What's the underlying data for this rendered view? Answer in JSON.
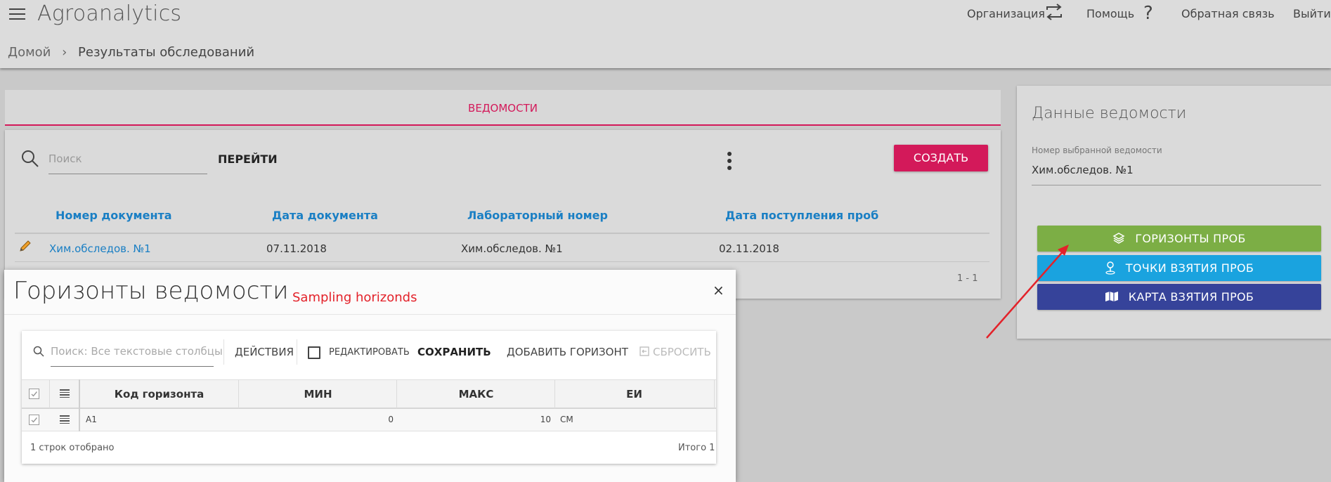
{
  "app": {
    "title": "Agroanalytics"
  },
  "header": {
    "org_label": "Организация",
    "help_label": "Помощь",
    "feedback_label": "Обратная связь",
    "logout_label": "Выйти"
  },
  "breadcrumb": {
    "home": "Домой",
    "current": "Результаты обследований"
  },
  "tab": {
    "label": "ВЕДОМОСТИ"
  },
  "list": {
    "search_placeholder": "Поиск",
    "goto_label": "ПЕРЕЙТИ",
    "create_label": "СОЗДАТЬ",
    "columns": [
      "Номер документа",
      "Дата документа",
      "Лабораторный номер",
      "Дата поступления проб"
    ],
    "rows": [
      {
        "doc_number": "Хим.обследов. №1",
        "doc_date": "07.11.2018",
        "lab_number": "Хим.обследов. №1",
        "receipt_date": "02.11.2018"
      }
    ],
    "pager": "1 - 1"
  },
  "details": {
    "title": "Данные ведомости",
    "number_label": "Номер выбранной ведомости",
    "number_value": "Хим.обследов. №1",
    "btn_horizons": "ГОРИЗОНТЫ ПРОБ",
    "btn_points": "ТОЧКИ ВЗЯТИЯ ПРОБ",
    "btn_map": "КАРТА ВЗЯТИЯ ПРОБ",
    "colors": {
      "horizons": "#7cae45",
      "points": "#1aa3df",
      "map": "#36439a",
      "accent": "#d3195a"
    }
  },
  "dialog": {
    "title": "Горизонты ведомости",
    "annotation": "Sampling horizonds",
    "close": "×",
    "search_placeholder": "Поиск: Все текстовые столбцы",
    "actions_label": "ДЕЙСТВИЯ",
    "edit_label": "РЕДАКТИРОВАТЬ",
    "save_label": "СОХРАНИТЬ",
    "add_label": "ДОБАВИТЬ ГОРИЗОНТ",
    "reset_label": "СБРОСИТЬ",
    "columns": [
      "Код горизонта",
      "МИН",
      "МАКС",
      "ЕИ"
    ],
    "rows": [
      {
        "code": "A1",
        "min": "0",
        "max": "10",
        "unit": "СМ"
      }
    ],
    "footer_shown": "1 строк отобрано",
    "footer_total": "Итого 1"
  }
}
